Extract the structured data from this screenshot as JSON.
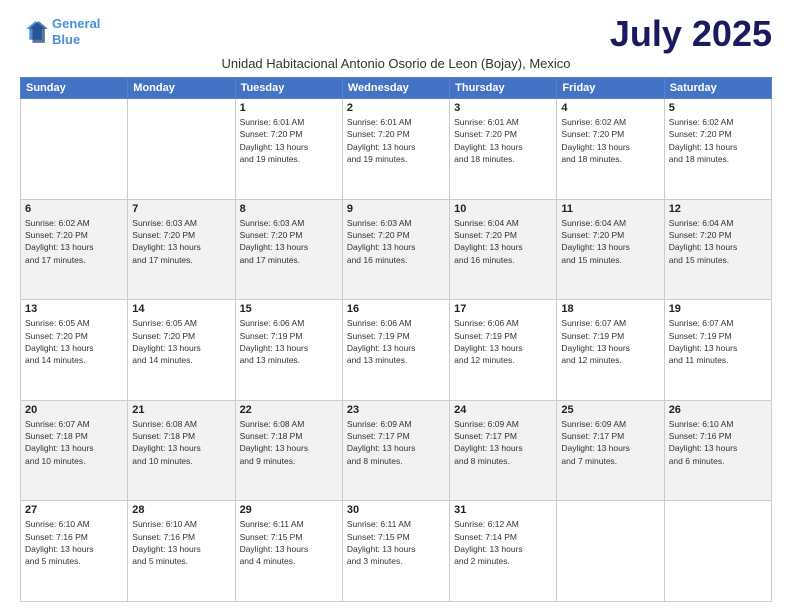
{
  "logo": {
    "line1": "General",
    "line2": "Blue"
  },
  "title": "July 2025",
  "location": "Unidad Habitacional Antonio Osorio de Leon (Bojay), Mexico",
  "days_header": [
    "Sunday",
    "Monday",
    "Tuesday",
    "Wednesday",
    "Thursday",
    "Friday",
    "Saturday"
  ],
  "weeks": [
    [
      {
        "num": "",
        "info": ""
      },
      {
        "num": "",
        "info": ""
      },
      {
        "num": "1",
        "info": "Sunrise: 6:01 AM\nSunset: 7:20 PM\nDaylight: 13 hours\nand 19 minutes."
      },
      {
        "num": "2",
        "info": "Sunrise: 6:01 AM\nSunset: 7:20 PM\nDaylight: 13 hours\nand 19 minutes."
      },
      {
        "num": "3",
        "info": "Sunrise: 6:01 AM\nSunset: 7:20 PM\nDaylight: 13 hours\nand 18 minutes."
      },
      {
        "num": "4",
        "info": "Sunrise: 6:02 AM\nSunset: 7:20 PM\nDaylight: 13 hours\nand 18 minutes."
      },
      {
        "num": "5",
        "info": "Sunrise: 6:02 AM\nSunset: 7:20 PM\nDaylight: 13 hours\nand 18 minutes."
      }
    ],
    [
      {
        "num": "6",
        "info": "Sunrise: 6:02 AM\nSunset: 7:20 PM\nDaylight: 13 hours\nand 17 minutes."
      },
      {
        "num": "7",
        "info": "Sunrise: 6:03 AM\nSunset: 7:20 PM\nDaylight: 13 hours\nand 17 minutes."
      },
      {
        "num": "8",
        "info": "Sunrise: 6:03 AM\nSunset: 7:20 PM\nDaylight: 13 hours\nand 17 minutes."
      },
      {
        "num": "9",
        "info": "Sunrise: 6:03 AM\nSunset: 7:20 PM\nDaylight: 13 hours\nand 16 minutes."
      },
      {
        "num": "10",
        "info": "Sunrise: 6:04 AM\nSunset: 7:20 PM\nDaylight: 13 hours\nand 16 minutes."
      },
      {
        "num": "11",
        "info": "Sunrise: 6:04 AM\nSunset: 7:20 PM\nDaylight: 13 hours\nand 15 minutes."
      },
      {
        "num": "12",
        "info": "Sunrise: 6:04 AM\nSunset: 7:20 PM\nDaylight: 13 hours\nand 15 minutes."
      }
    ],
    [
      {
        "num": "13",
        "info": "Sunrise: 6:05 AM\nSunset: 7:20 PM\nDaylight: 13 hours\nand 14 minutes."
      },
      {
        "num": "14",
        "info": "Sunrise: 6:05 AM\nSunset: 7:20 PM\nDaylight: 13 hours\nand 14 minutes."
      },
      {
        "num": "15",
        "info": "Sunrise: 6:06 AM\nSunset: 7:19 PM\nDaylight: 13 hours\nand 13 minutes."
      },
      {
        "num": "16",
        "info": "Sunrise: 6:06 AM\nSunset: 7:19 PM\nDaylight: 13 hours\nand 13 minutes."
      },
      {
        "num": "17",
        "info": "Sunrise: 6:06 AM\nSunset: 7:19 PM\nDaylight: 13 hours\nand 12 minutes."
      },
      {
        "num": "18",
        "info": "Sunrise: 6:07 AM\nSunset: 7:19 PM\nDaylight: 13 hours\nand 12 minutes."
      },
      {
        "num": "19",
        "info": "Sunrise: 6:07 AM\nSunset: 7:19 PM\nDaylight: 13 hours\nand 11 minutes."
      }
    ],
    [
      {
        "num": "20",
        "info": "Sunrise: 6:07 AM\nSunset: 7:18 PM\nDaylight: 13 hours\nand 10 minutes."
      },
      {
        "num": "21",
        "info": "Sunrise: 6:08 AM\nSunset: 7:18 PM\nDaylight: 13 hours\nand 10 minutes."
      },
      {
        "num": "22",
        "info": "Sunrise: 6:08 AM\nSunset: 7:18 PM\nDaylight: 13 hours\nand 9 minutes."
      },
      {
        "num": "23",
        "info": "Sunrise: 6:09 AM\nSunset: 7:17 PM\nDaylight: 13 hours\nand 8 minutes."
      },
      {
        "num": "24",
        "info": "Sunrise: 6:09 AM\nSunset: 7:17 PM\nDaylight: 13 hours\nand 8 minutes."
      },
      {
        "num": "25",
        "info": "Sunrise: 6:09 AM\nSunset: 7:17 PM\nDaylight: 13 hours\nand 7 minutes."
      },
      {
        "num": "26",
        "info": "Sunrise: 6:10 AM\nSunset: 7:16 PM\nDaylight: 13 hours\nand 6 minutes."
      }
    ],
    [
      {
        "num": "27",
        "info": "Sunrise: 6:10 AM\nSunset: 7:16 PM\nDaylight: 13 hours\nand 5 minutes."
      },
      {
        "num": "28",
        "info": "Sunrise: 6:10 AM\nSunset: 7:16 PM\nDaylight: 13 hours\nand 5 minutes."
      },
      {
        "num": "29",
        "info": "Sunrise: 6:11 AM\nSunset: 7:15 PM\nDaylight: 13 hours\nand 4 minutes."
      },
      {
        "num": "30",
        "info": "Sunrise: 6:11 AM\nSunset: 7:15 PM\nDaylight: 13 hours\nand 3 minutes."
      },
      {
        "num": "31",
        "info": "Sunrise: 6:12 AM\nSunset: 7:14 PM\nDaylight: 13 hours\nand 2 minutes."
      },
      {
        "num": "",
        "info": ""
      },
      {
        "num": "",
        "info": ""
      }
    ]
  ]
}
